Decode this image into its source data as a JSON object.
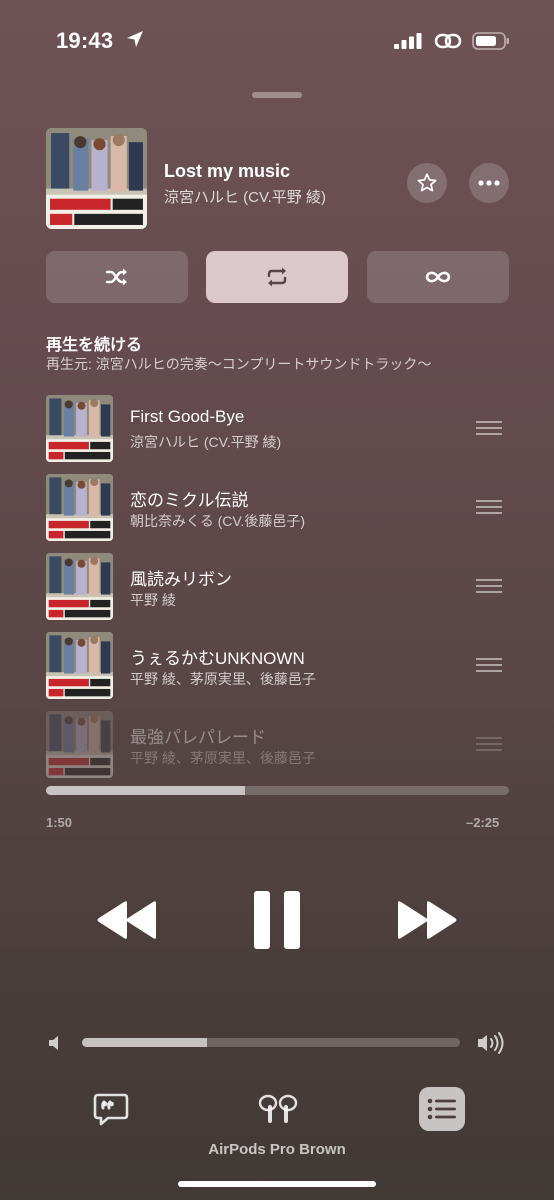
{
  "status_bar": {
    "time": "19:43"
  },
  "now_playing": {
    "title": "Lost my music",
    "artist": "涼宮ハルヒ (CV.平野 綾)",
    "artwork": "album-cover"
  },
  "modes": [
    {
      "icon": "shuffle-icon",
      "active": false
    },
    {
      "icon": "repeat-icon",
      "active": true
    },
    {
      "icon": "infinity-icon",
      "active": false
    }
  ],
  "queue_section": {
    "title": "再生を続ける",
    "subtitle": "再生元: 涼宮ハルヒの完奏〜コンプリートサウンドトラック〜"
  },
  "queue": [
    {
      "title": "First Good-Bye",
      "artist": "涼宮ハルヒ (CV.平野 綾)"
    },
    {
      "title": "恋のミクル伝説",
      "artist": "朝比奈みくる (CV.後藤邑子)"
    },
    {
      "title": "風読みリボン",
      "artist": "平野 綾"
    },
    {
      "title": "うぇるかむUNKNOWN",
      "artist": "平野 綾、茅原実里、後藤邑子"
    },
    {
      "title": "最強パレパレード",
      "artist": "平野 綾、茅原実里、後藤邑子"
    }
  ],
  "progress": {
    "elapsed": "1:50",
    "remaining": "–2:25",
    "fraction": 0.43
  },
  "volume": {
    "fraction": 0.33
  },
  "output_device": "AirPods Pro Brown"
}
